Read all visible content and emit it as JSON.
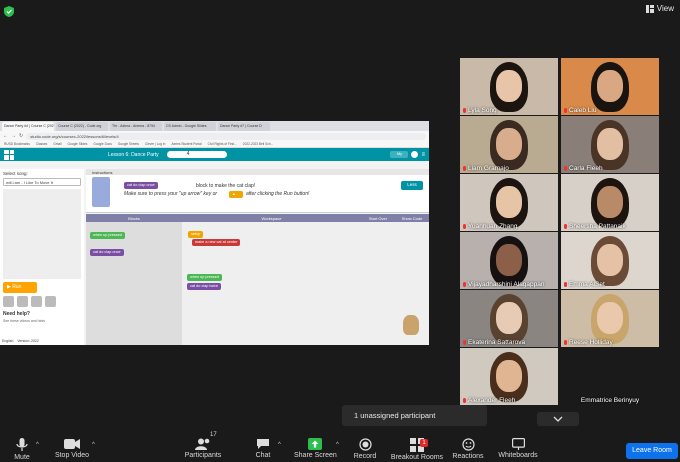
{
  "top": {
    "view_label": "View"
  },
  "browser": {
    "tabs": [
      "Dance Party #4 | Course C (2023)",
      "Course C (2022) - Code.org",
      "Thr - Ashna - Anema - 8794",
      "CS Admin - Google Slides",
      "Dance Party #7 | Course D"
    ],
    "url": "studio.code.org/s/coursec-2022/lessons/6/levels/4",
    "bookmarks": [
      "RUSD Bookmarks",
      "Classes",
      "Gmail",
      "Google Slides",
      "Google Docs",
      "Google Sheets",
      "Clever | Log in",
      "Aeries Student Portal",
      "Civil Rights of First...",
      "2022-2023 Bell Sch..."
    ]
  },
  "codeorg": {
    "lesson_title": "Lesson 6: Dance Party",
    "progress_level": "4",
    "header_btn": "My",
    "song_label": "Select song:",
    "song_value": "will.i.am - I Like To Move It",
    "run_label": "Run",
    "need_help": "Need help?",
    "see_videos": "See these videos and hints",
    "language": "English",
    "version": "Version: 2022",
    "instructions_tab": "Instructions",
    "instructions_line1": "block to make the cat clap!",
    "instructions_line2": "Make sure to press your \"up arrow\" key or",
    "instructions_line3": "after clicking the Run button!",
    "less_btn": "Less",
    "blocks_label": "Blocks",
    "workspace_label": "Workspace",
    "start_over": "Start Over",
    "show_code": "Show Code",
    "blocks": {
      "when_pressed": "when  up  pressed",
      "do_once": "cat  do  clap  once",
      "setup": "setup",
      "make_new": "make a new  cat  at  center",
      "ws_when": "when  up  pressed",
      "ws_do": "cat  do  clap  twice",
      "small_do": "cat  do  clap  once"
    }
  },
  "participants_gallery": [
    {
      "name": "Lyla Song",
      "muted": true,
      "bg": "#c9b9a8",
      "skin": "#e8c4a8",
      "hair": "#1c140f"
    },
    {
      "name": "Caleb Liu",
      "muted": true,
      "bg": "#d98a4a",
      "skin": "#d9a882",
      "hair": "#1a1410"
    },
    {
      "name": "Liam Gramajo",
      "muted": true,
      "bg": "#b9aa92",
      "skin": "#d7ad8e",
      "hair": "#3a2a20"
    },
    {
      "name": "Carla Fleeh",
      "muted": true,
      "bg": "#8a7f78",
      "skin": "#e2bfa3",
      "hair": "#4a3426"
    },
    {
      "name": "Yuanhuan Zhang",
      "muted": true,
      "bg": "#cfc6bd",
      "skin": "#e6c4a6",
      "hair": "#1b1410"
    },
    {
      "name": "Sheersha Pattanaik",
      "muted": true,
      "bg": "#d6d0c8",
      "skin": "#b98a68",
      "hair": "#1d1410"
    },
    {
      "name": "Vijayadharshini Alagappan",
      "muted": true,
      "bg": "#b7b0ad",
      "skin": "#8c6048",
      "hair": "#161010"
    },
    {
      "name": "Emma AlSet",
      "muted": true,
      "bg": "#ddd6cf",
      "skin": "#e5c1a5",
      "hair": "#6a4c36"
    },
    {
      "name": "Ekaterina Sattarova",
      "muted": true,
      "bg": "#8a8580",
      "skin": "#e8cbb5",
      "hair": "#5a4230"
    },
    {
      "name": "Reese Holliday",
      "muted": true,
      "bg": "#cdbca6",
      "skin": "#e9c8ac",
      "hair": "#c8a56a"
    },
    {
      "name": "Alexander Fleeh",
      "muted": true,
      "bg": "#d0c9c0",
      "skin": "#e0b592",
      "hair": "#4a2e1c"
    },
    {
      "name": "Emmatrice Berinyuy",
      "muted": false,
      "bg": "#1a1a1a",
      "skin": "",
      "hair": ""
    }
  ],
  "popup": {
    "unassigned": "1 unassigned participant"
  },
  "toolbar": {
    "mute": "Mute",
    "stop_video": "Stop Video",
    "participants": "Participants",
    "participants_count": "17",
    "chat": "Chat",
    "share_screen": "Share Screen",
    "record": "Record",
    "breakout_rooms": "Breakout Rooms",
    "breakout_badge": "1",
    "reactions": "Reactions",
    "whiteboards": "Whiteboards",
    "leave_room": "Leave Room"
  },
  "colors": {
    "accent_green": "#2dbf4e",
    "leave_blue": "#0e72ed",
    "codeorg_teal": "#0093a4"
  }
}
